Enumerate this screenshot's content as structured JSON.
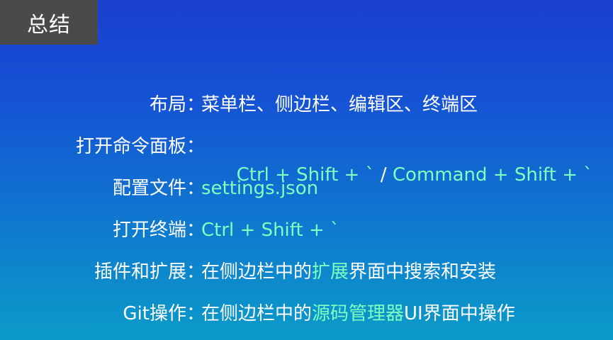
{
  "slide": {
    "title": "总结",
    "items": [
      {
        "label": "布局",
        "colon": "：",
        "value": [
          {
            "text": "菜单栏、侧边栏、编辑区、终端区",
            "style": "white"
          }
        ]
      },
      {
        "label": "打开命令面板",
        "colon": "：",
        "value": [
          {
            "text": "Ctrl + Shift + ` ",
            "style": "green"
          },
          {
            "text": "/ ",
            "style": "white"
          },
          {
            "text": "Command + Shift + `",
            "style": "green"
          }
        ]
      },
      {
        "label": "配置文件",
        "colon": "：",
        "value": [
          {
            "text": "settings.json",
            "style": "green"
          }
        ]
      },
      {
        "label": "打开终端",
        "colon": "：",
        "value": [
          {
            "text": "Ctrl + Shift + `",
            "style": "green"
          }
        ]
      },
      {
        "label": "插件和扩展",
        "colon": "：",
        "value": [
          {
            "text": "在侧边栏中的",
            "style": "white"
          },
          {
            "text": "扩展",
            "style": "green"
          },
          {
            "text": "界面中搜索和安装",
            "style": "white"
          }
        ]
      },
      {
        "label": "Git操作",
        "colon": "：",
        "value": [
          {
            "text": "在侧边栏中的",
            "style": "white"
          },
          {
            "text": "源码管理器",
            "style": "green"
          },
          {
            "text": "UI界面中操作",
            "style": "white"
          }
        ]
      }
    ]
  },
  "colors": {
    "background_top": "#1a3fd0",
    "background_bottom": "#0b9bc8",
    "title_tab_bg": "#4a4a4a",
    "text_white": "#ffffff",
    "text_highlight": "#7dffc0"
  }
}
